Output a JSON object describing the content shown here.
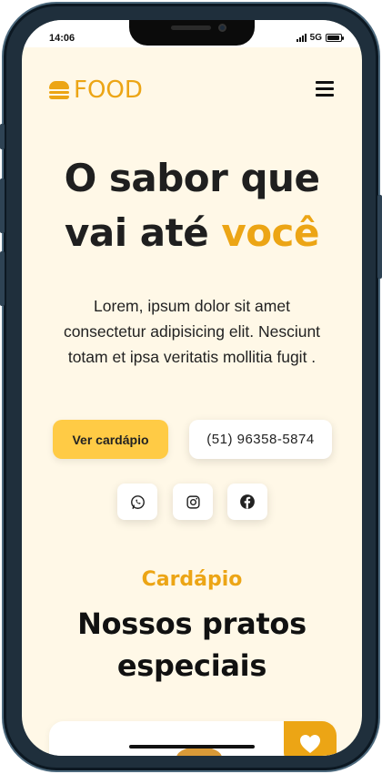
{
  "status_bar": {
    "time": "14:06",
    "network": "5G",
    "battery_level": 0.9
  },
  "header": {
    "brand": "FOOD",
    "brand_icon": "burger-icon",
    "menu_icon": "hamburger-menu-icon"
  },
  "hero": {
    "title_line1": "O sabor que",
    "title_line2_plain": "vai até",
    "title_line2_accent": "você",
    "description": "Lorem, ipsum dolor sit amet consectetur adipisicing elit. Nesciunt totam et ipsa veritatis mollitia fugit .",
    "menu_button_label": "Ver cardápio",
    "phone_button_label": "(51) 96358-5874"
  },
  "social": [
    {
      "icon": "whatsapp-icon"
    },
    {
      "icon": "instagram-icon"
    },
    {
      "icon": "facebook-icon"
    }
  ],
  "section": {
    "kicker": "Cardápio",
    "title": "Nossos pratos especiais"
  },
  "card": {
    "favorite_icon": "heart-icon"
  },
  "colors": {
    "accent": "#eca515",
    "button_yellow": "#ffcb45",
    "background": "#fff8e7",
    "text": "#1f1f1f"
  }
}
